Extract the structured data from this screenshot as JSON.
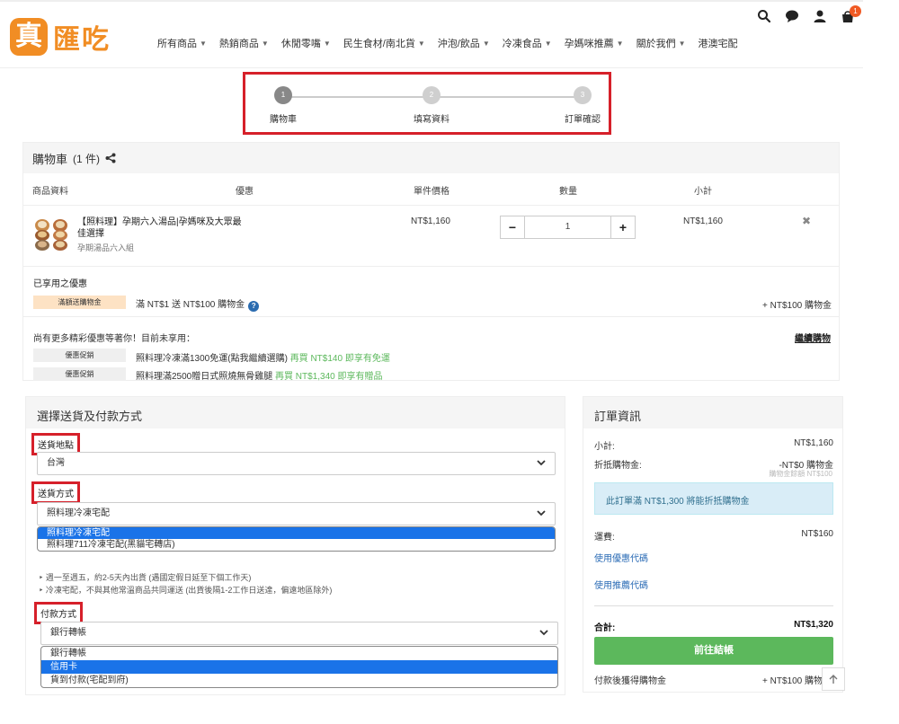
{
  "brand": {
    "logo_mark": "真",
    "logo_text": "匯吃",
    "accent": "#f18d24"
  },
  "nav": [
    {
      "label": "所有商品"
    },
    {
      "label": "熱銷商品"
    },
    {
      "label": "休閒零嘴"
    },
    {
      "label": "民生食材/南北貨"
    },
    {
      "label": "沖泡/飲品"
    },
    {
      "label": "冷凍食品"
    },
    {
      "label": "孕媽咪推薦"
    },
    {
      "label": "關於我們"
    },
    {
      "label": "港澳宅配"
    }
  ],
  "header_icons": [
    "search-icon",
    "chat-icon",
    "user-icon",
    "cart-icon"
  ],
  "cart_badge": "1",
  "steps": [
    {
      "num": "1",
      "label": "購物車"
    },
    {
      "num": "2",
      "label": "填寫資料"
    },
    {
      "num": "3",
      "label": "訂單確認"
    }
  ],
  "cart": {
    "title": "購物車",
    "count": "(1 件)",
    "columns": {
      "product": "商品資料",
      "promo": "優惠",
      "unit_price": "單件價格",
      "qty": "數量",
      "subtotal": "小計"
    },
    "item": {
      "name": "【照料理】孕期六入湯品|孕媽咪及大眾最佳選擇",
      "variant": "孕期湯品六入組",
      "unit_price": "NT$1,160",
      "qty": "1",
      "subtotal": "NT$1,160"
    },
    "applied_title": "已享用之優惠",
    "applied": {
      "tag": "滿額送購物金",
      "text": "滿 NT$1 送 NT$100 購物金",
      "reward": "+ NT$100 購物金"
    },
    "more_title": "尚有更多精彩優惠等著你！目前未享用：",
    "continue_label": "繼續購物",
    "promos": [
      {
        "tag": "優惠促銷",
        "text": "照料理冷凍滿1300免運(點我繼續選購)",
        "highlight": "再買 NT$140 即享有免運"
      },
      {
        "tag": "優惠促銷",
        "text": "照料理滿2500贈日式照燒無骨雞腿",
        "highlight": "再買 NT$1,340 即享有贈品"
      }
    ]
  },
  "shipping": {
    "title": "選擇送貨及付款方式",
    "location_label": "送貨地點",
    "location_value": "台灣",
    "method_label": "送貨方式",
    "method_value": "照料理冷凍宅配",
    "method_options": [
      "照料理冷凍宅配",
      "照料理711冷凍宅配(黑貓宅轉店)"
    ],
    "notes": [
      "週一至週五，約2-5天內出貨 (遇國定假日延至下個工作天)",
      "冷凍宅配，不與其他常溫商品共同運送 (出貨後隔1-2工作日送達，偏遠地區除外)"
    ],
    "payment_label": "付款方式",
    "payment_value": "銀行轉帳",
    "payment_options": [
      "銀行轉帳",
      "信用卡",
      "貨到付款(宅配到府)"
    ]
  },
  "order": {
    "title": "訂單資訊",
    "subtotal_label": "小計:",
    "subtotal_value": "NT$1,160",
    "credit_label": "折抵購物金:",
    "credit_value": "-NT$0 購物金",
    "credit_sub": "購物金餘額 NT$100",
    "info": "此訂單滿 NT$1,300 將能折抵購物金",
    "shipping_label": "運費:",
    "shipping_value": "NT$160",
    "coupon_link": "使用優惠代碼",
    "referral_link": "使用推薦代碼",
    "total_label": "合計:",
    "total_value": "NT$1,320",
    "checkout_label": "前往結帳",
    "earn_label": "付款後獲得購物金",
    "earn_value": "+ NT$100 購物"
  },
  "colors": {
    "highlight_border": "#d6202a",
    "checkout_green": "#5cb85c",
    "select_blue": "#1a73e8"
  }
}
